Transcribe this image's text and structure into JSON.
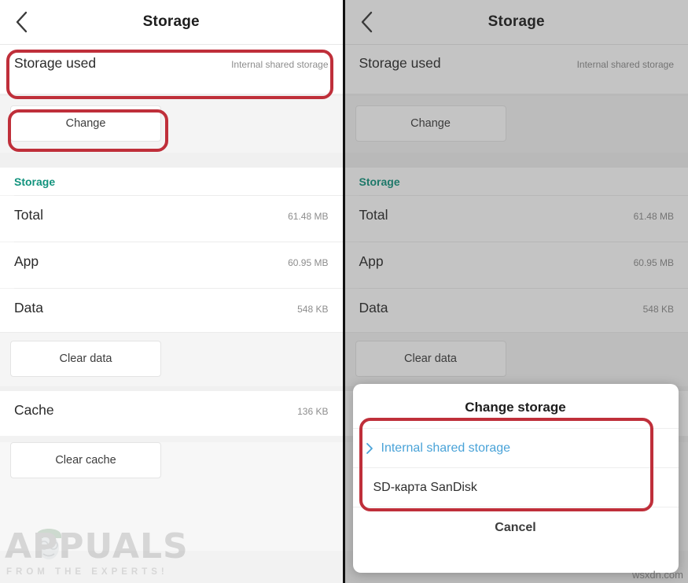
{
  "appbar": {
    "title": "Storage",
    "back_icon": "chevron-left-icon"
  },
  "storage_used": {
    "label": "Storage used",
    "value": "Internal shared storage"
  },
  "change_button": {
    "label": "Change"
  },
  "section": {
    "header": "Storage",
    "rows": [
      {
        "label": "Total",
        "value": "61.48 MB"
      },
      {
        "label": "App",
        "value": "60.95 MB"
      },
      {
        "label": "Data",
        "value": "548 KB"
      }
    ]
  },
  "clear_data_button": {
    "label": "Clear data"
  },
  "cache_row": {
    "label": "Cache",
    "value": "136 KB"
  },
  "clear_cache_button": {
    "label": "Clear cache"
  },
  "dialog": {
    "title": "Change storage",
    "options": [
      {
        "label": "Internal shared storage",
        "selected": true,
        "icon": "chevron-right-icon"
      },
      {
        "label": "SD-карта SanDisk",
        "selected": false,
        "icon": ""
      }
    ],
    "cancel": "Cancel"
  },
  "watermarks": {
    "appuals_word": "APPUALS",
    "appuals_tagline": "FROM THE EXPERTS!",
    "wsxdn": "wsxdn.com"
  },
  "colors": {
    "annotation_red": "#bf2f3a",
    "section_teal": "#12937d",
    "link_blue": "#4aa3d8"
  }
}
